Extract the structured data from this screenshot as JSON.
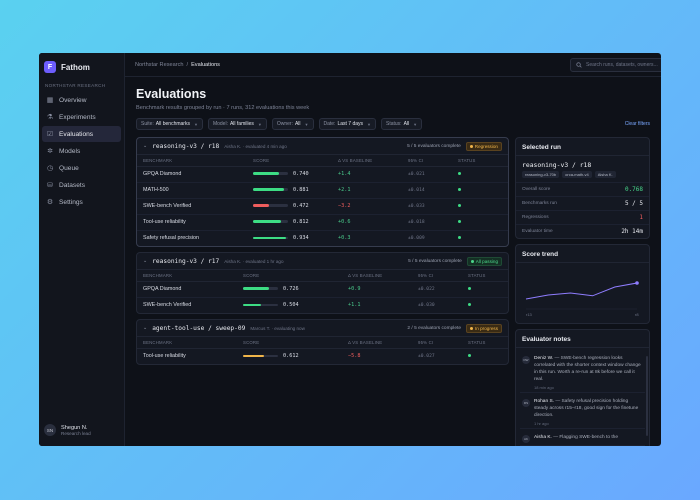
{
  "brand": {
    "initial": "F",
    "name": "Fathom",
    "org_label": "NORTHSTAR RESEARCH",
    "color": "#6d5dfc"
  },
  "nav": [
    {
      "label": "Overview",
      "icon": "grid-icon"
    },
    {
      "label": "Experiments",
      "icon": "flask-icon"
    },
    {
      "label": "Evaluations",
      "icon": "checklist-icon",
      "active": true
    },
    {
      "label": "Models",
      "icon": "network-icon"
    },
    {
      "label": "Queue",
      "icon": "clock-icon"
    },
    {
      "label": "Datasets",
      "icon": "database-icon"
    },
    {
      "label": "Settings",
      "icon": "gear-icon"
    }
  ],
  "user": {
    "initials": "SN",
    "name": "Shegun N.",
    "role": "Research lead"
  },
  "breadcrumb": {
    "parent": "Northstar Research",
    "sep": "/",
    "current": "Evaluations"
  },
  "search": {
    "placeholder": "Search runs, datasets, owners..."
  },
  "page": {
    "title": "Evaluations",
    "subtitle": "Benchmark results grouped by run · 7 runs, 312 evaluations this week"
  },
  "filters": [
    {
      "label": "Suite:",
      "value": "All benchmarks"
    },
    {
      "label": "Model:",
      "value": "All families"
    },
    {
      "label": "Owner:",
      "value": "All"
    },
    {
      "label": "Date:",
      "value": "Last 7 days"
    },
    {
      "label": "Status:",
      "value": "All"
    }
  ],
  "clear_filters": "Clear filters",
  "table_headers": {
    "benchmark": "BENCHMARK",
    "score": "SCORE",
    "delta": "Δ VS BASELINE",
    "ci": "95% CI",
    "status": "STATUS"
  },
  "runs": [
    {
      "name": "reasoning-v3 / r18",
      "meta": "Aisha K. · evaluated 4 min ago",
      "count": "5 / 5 evaluators complete",
      "badge": "Regression",
      "badge_type": "regression",
      "rows": [
        {
          "benchmark": "GPQA Diamond",
          "score": "0.740",
          "fill": 0.74,
          "delta": "+1.4",
          "neg": false,
          "ci": "±0.021",
          "color": "#3ddc84"
        },
        {
          "benchmark": "MATH-500",
          "score": "0.881",
          "fill": 0.88,
          "delta": "+2.1",
          "neg": false,
          "ci": "±0.014",
          "color": "#3ddc84"
        },
        {
          "benchmark": "SWE-bench Verified",
          "score": "0.472",
          "fill": 0.47,
          "delta": "−3.2",
          "neg": true,
          "ci": "±0.033",
          "color": "#ef5d5d"
        },
        {
          "benchmark": "Tool-use reliability",
          "score": "0.812",
          "fill": 0.81,
          "delta": "+0.6",
          "neg": false,
          "ci": "±0.018",
          "color": "#3ddc84"
        },
        {
          "benchmark": "Safety refusal precision",
          "score": "0.934",
          "fill": 0.93,
          "delta": "+0.3",
          "neg": false,
          "ci": "±0.009",
          "color": "#3ddc84"
        }
      ]
    },
    {
      "name": "reasoning-v3 / r17",
      "meta": "Aisha K. · evaluated 1 hr ago",
      "count": "5 / 5 evaluators complete",
      "badge": "All passing",
      "badge_type": "passing",
      "rows": [
        {
          "benchmark": "GPQA Diamond",
          "score": "0.726",
          "fill": 0.73,
          "delta": "+0.9",
          "neg": false,
          "ci": "±0.022",
          "color": "#3ddc84"
        },
        {
          "benchmark": "SWE-bench Verified",
          "score": "0.504",
          "fill": 0.5,
          "delta": "+1.1",
          "neg": false,
          "ci": "±0.030",
          "color": "#3ddc84"
        }
      ]
    },
    {
      "name": "agent-tool-use / sweep-09",
      "meta": "Marcus T. · evaluating now",
      "count": "2 / 5 evaluators complete",
      "badge": "In progress",
      "badge_type": "progress",
      "rows": [
        {
          "benchmark": "Tool-use reliability",
          "score": "0.612",
          "fill": 0.61,
          "delta": "−5.8",
          "neg": true,
          "ci": "±0.027",
          "color": "#f0b54a"
        }
      ]
    }
  ],
  "selected_run": {
    "title": "Selected run",
    "name": "reasoning-v3 / r18",
    "tags": [
      "reasoning-v3-70b",
      "orca-math-v4",
      "Aisha K."
    ],
    "stats": [
      {
        "label": "Overall score",
        "value": "0.768",
        "tone": "green"
      },
      {
        "label": "Benchmarks run",
        "value": "5 / 5",
        "tone": ""
      },
      {
        "label": "Regressions",
        "value": "1",
        "tone": "red"
      },
      {
        "label": "Evaluator time",
        "value": "2h 14m",
        "tone": ""
      }
    ]
  },
  "score_trend": {
    "title": "Score trend",
    "x_start": "r13",
    "x_end": "r8",
    "values": [
      0.72,
      0.73,
      0.735,
      0.728,
      0.75,
      0.76
    ],
    "color": "#8f7dff"
  },
  "notes": {
    "title": "Evaluator notes",
    "items": [
      {
        "initials": "DW",
        "author": "Deniz W.",
        "text": " — SWE-bench regression looks correlated with the shorter context window change in this run. Worth a re-run at 8k before we call it real.",
        "time": "18 min ago"
      },
      {
        "initials": "RS",
        "author": "Rohan S.",
        "text": " — Safety refusal precision holding steady across r15–r18, good sign for the finetune direction.",
        "time": "1 hr ago"
      },
      {
        "initials": "AK",
        "author": "Aisha K.",
        "text": " — Flagging SWE-bench to the",
        "time": ""
      }
    ]
  }
}
